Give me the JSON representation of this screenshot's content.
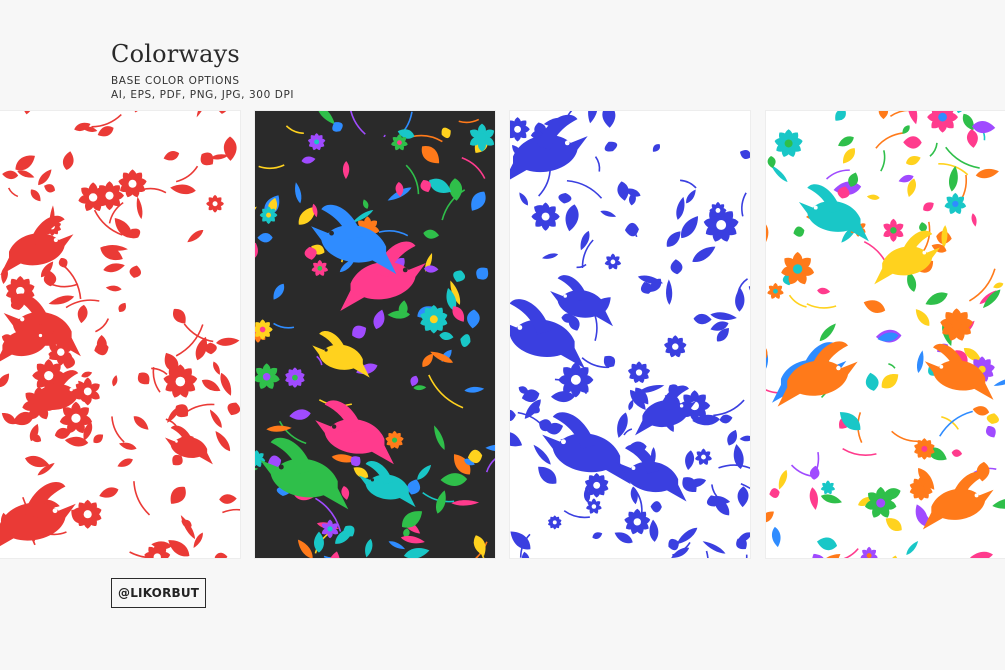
{
  "header": {
    "title": "Colorways",
    "line1": "BASE COLOR OPTIONS",
    "line2": "AI, EPS, PDF, PNG, JPG, 300 DPI"
  },
  "handle": "@LIKORBUT",
  "colorways": [
    {
      "background": "#ffffff",
      "motif_colors": [
        "#ea3a36"
      ],
      "style": "single-color red on white"
    },
    {
      "background": "#2a2a2a",
      "motif_colors": [
        "#ff3b8d",
        "#ffd21e",
        "#2fbf4a",
        "#2f8cff",
        "#a04bff",
        "#ff7a1a",
        "#19c7c7"
      ],
      "style": "multicolor on black"
    },
    {
      "background": "#ffffff",
      "motif_colors": [
        "#3a3fe0"
      ],
      "style": "single-color blue on white"
    },
    {
      "background": "#ffffff",
      "motif_colors": [
        "#ff3b8d",
        "#ffd21e",
        "#2fbf4a",
        "#2f8cff",
        "#a04bff",
        "#ff7a1a",
        "#19c7c7"
      ],
      "style": "multicolor on white"
    }
  ]
}
